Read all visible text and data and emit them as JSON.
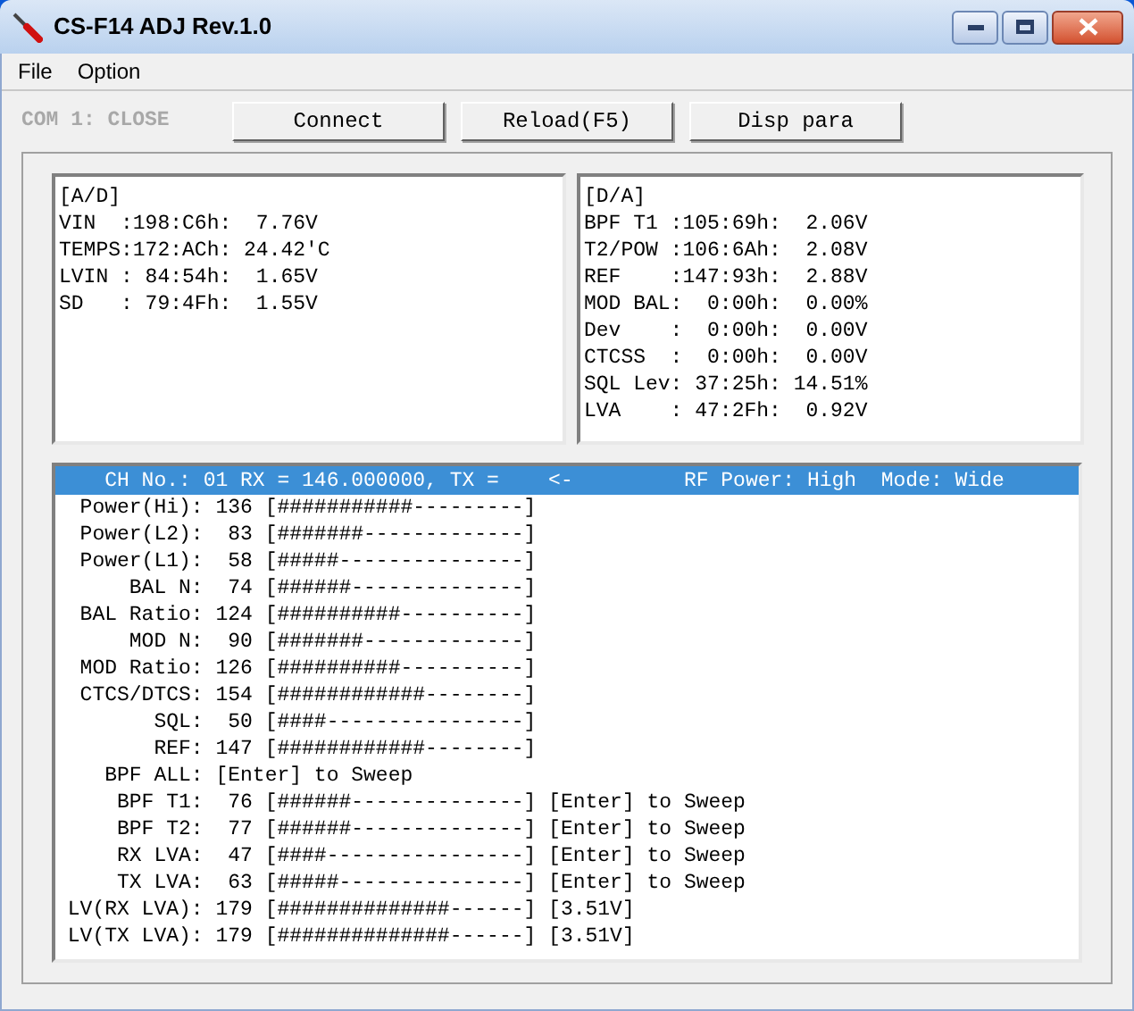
{
  "window": {
    "title": "CS-F14 ADJ Rev.1.0"
  },
  "menu": [
    "File",
    "Option"
  ],
  "port_status": "COM 1: CLOSE",
  "buttons": [
    "Connect",
    "Reload(F5)",
    "Disp para"
  ],
  "ad_panel": [
    "[A/D]",
    "VIN  :198:C6h:  7.76V",
    "TEMPS:172:ACh: 24.42'C",
    "LVIN : 84:54h:  1.65V",
    "SD   : 79:4Fh:  1.55V"
  ],
  "da_panel": [
    "[D/A]",
    "BPF T1 :105:69h:  2.06V",
    "T2/POW :106:6Ah:  2.08V",
    "REF    :147:93h:  2.88V",
    "MOD BAL:  0:00h:  0.00%",
    "Dev    :  0:00h:  0.00V",
    "CTCSS  :  0:00h:  0.00V",
    "SQL Lev: 37:25h: 14.51%",
    "LVA    : 47:2Fh:  0.92V"
  ],
  "list": [
    {
      "text": "    CH No.: 01 RX = 146.000000, TX =    <-         RF Power: High  Mode: Wide",
      "selected": true
    },
    {
      "text": "  Power(Hi): 136 [###########---------]",
      "selected": false
    },
    {
      "text": "  Power(L2):  83 [#######-------------]",
      "selected": false
    },
    {
      "text": "  Power(L1):  58 [#####---------------]",
      "selected": false
    },
    {
      "text": "      BAL N:  74 [######--------------]",
      "selected": false
    },
    {
      "text": "  BAL Ratio: 124 [##########----------]",
      "selected": false
    },
    {
      "text": "      MOD N:  90 [#######-------------]",
      "selected": false
    },
    {
      "text": "  MOD Ratio: 126 [##########----------]",
      "selected": false
    },
    {
      "text": "  CTCS/DTCS: 154 [############--------]",
      "selected": false
    },
    {
      "text": "        SQL:  50 [####----------------]",
      "selected": false
    },
    {
      "text": "        REF: 147 [############--------]",
      "selected": false
    },
    {
      "text": "    BPF ALL: [Enter] to Sweep",
      "selected": false
    },
    {
      "text": "     BPF T1:  76 [######--------------] [Enter] to Sweep",
      "selected": false
    },
    {
      "text": "     BPF T2:  77 [######--------------] [Enter] to Sweep",
      "selected": false
    },
    {
      "text": "     RX LVA:  47 [####----------------] [Enter] to Sweep",
      "selected": false
    },
    {
      "text": "     TX LVA:  63 [#####---------------] [Enter] to Sweep",
      "selected": false
    },
    {
      "text": " LV(RX LVA): 179 [##############------] [3.51V]",
      "selected": false
    },
    {
      "text": " LV(TX LVA): 179 [##############------] [3.51V]",
      "selected": false
    }
  ]
}
